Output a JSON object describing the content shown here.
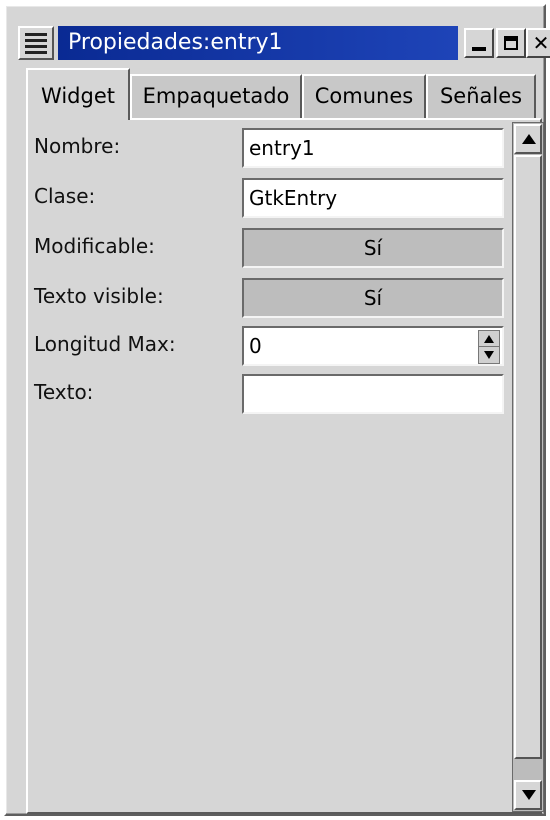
{
  "window": {
    "title": "Propiedades:entry1"
  },
  "tabs": [
    {
      "label": "Widget",
      "active": true
    },
    {
      "label": "Empaquetado",
      "active": false
    },
    {
      "label": "Comunes",
      "active": false
    },
    {
      "label": "Señales",
      "active": false
    }
  ],
  "properties": {
    "nombre": {
      "label": "Nombre:",
      "value": "entry1"
    },
    "clase": {
      "label": "Clase:",
      "value": "GtkEntry"
    },
    "modificable": {
      "label": "Modificable:",
      "value": "Sí"
    },
    "texto_visible": {
      "label": "Texto visible:",
      "value": "Sí"
    },
    "longitud_max": {
      "label": "Longitud Max:",
      "value": "0"
    },
    "texto": {
      "label": "Texto:",
      "value": ""
    }
  },
  "colors": {
    "titlebar": "#0a2a93",
    "window_bg": "#d6d6d6"
  },
  "icons": [
    "window-menu-icon",
    "minimize-icon",
    "maximize-icon",
    "close-icon",
    "spin-up-icon",
    "spin-down-icon",
    "scroll-up-icon",
    "scroll-down-icon"
  ]
}
